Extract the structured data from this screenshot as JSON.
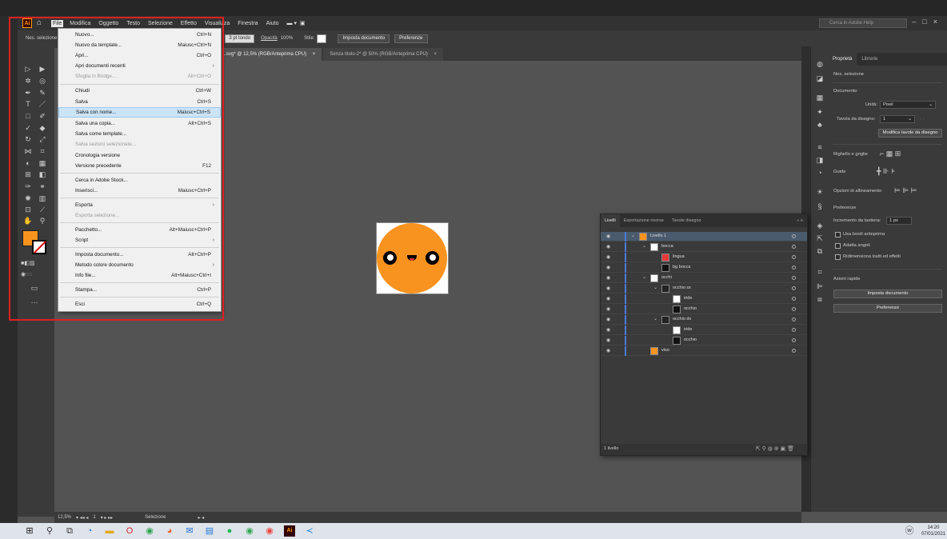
{
  "menubar": {
    "logo": "Ai",
    "items": [
      "File",
      "Modifica",
      "Oggetto",
      "Testo",
      "Selezione",
      "Effetto",
      "Visualizza",
      "Finestra",
      "Aiuto"
    ],
    "search_placeholder": "Cerca in Adobe Help"
  },
  "controlbar": {
    "selection": "Nes. selezione",
    "stroke": "3 pt tondo",
    "opacity_label": "Opacità",
    "opacity": "100%",
    "style_label": "Stile:",
    "setup_button": "Imposta documento",
    "prefs_button": "Preferenze"
  },
  "tabs": [
    {
      "label": "...svg* @ 12,5% (RGB/Anteprima CPU)",
      "close": "×"
    },
    {
      "label": "Senza titolo-2* @ 50% (RGB/Anteprima CPU)",
      "close": "×"
    }
  ],
  "file_menu": [
    {
      "label": "Nuovo...",
      "shortcut": "Ctrl+N"
    },
    {
      "label": "Nuovo da template...",
      "shortcut": "Maiusc+Ctrl+N"
    },
    {
      "label": "Apri...",
      "shortcut": "Ctrl+O"
    },
    {
      "label": "Apri documenti recenti",
      "shortcut": "›"
    },
    {
      "label": "Sfoglia in Bridge...",
      "shortcut": "Alt+Ctrl+O",
      "disabled": true
    },
    {
      "label": "Chiudi",
      "shortcut": "Ctrl+W"
    },
    {
      "label": "Salva",
      "shortcut": "Ctrl+S"
    },
    {
      "label": "Salva con nome...",
      "shortcut": "Maiusc+Ctrl+S",
      "highlighted": true
    },
    {
      "label": "Salva una copia...",
      "shortcut": "Alt+Ctrl+S"
    },
    {
      "label": "Salva come template...",
      "shortcut": ""
    },
    {
      "label": "Salva sezioni selezionate...",
      "shortcut": "",
      "disabled": true
    },
    {
      "label": "Cronologia versione",
      "shortcut": ""
    },
    {
      "label": "Versione precedente",
      "shortcut": "F12"
    },
    {
      "label": "Cerca in Adobe Stock...",
      "shortcut": ""
    },
    {
      "label": "Inserisci...",
      "shortcut": "Maiusc+Ctrl+P"
    },
    {
      "label": "Esporta",
      "shortcut": "›"
    },
    {
      "label": "Esporta selezione...",
      "shortcut": "",
      "disabled": true
    },
    {
      "label": "Pacchetto...",
      "shortcut": "Alt+Maiusc+Ctrl+P"
    },
    {
      "label": "Script",
      "shortcut": "›"
    },
    {
      "label": "Imposta documento...",
      "shortcut": "Alt+Ctrl+P"
    },
    {
      "label": "Metodo colore documento",
      "shortcut": "›"
    },
    {
      "label": "Info file...",
      "shortcut": "Alt+Maiusc+Ctrl+I"
    },
    {
      "label": "Stampa...",
      "shortcut": "Ctrl+P"
    },
    {
      "label": "Esci",
      "shortcut": "Ctrl+Q"
    }
  ],
  "properties": {
    "tabs": [
      "Proprietà",
      "Librerie"
    ],
    "no_selection": "Nes. selezione",
    "document": "Documento",
    "units_label": "Unità:",
    "units": "Pixel",
    "artboard_label": "Tavola da disegno:",
    "artboard": "1",
    "edit_artboards": "Modifica tavole da disegno",
    "rulers": "Righello e griglie",
    "guides": "Guide",
    "align_options": "Opzioni di allineamento",
    "preferences": "Preferenze",
    "keyboard_inc_label": "Incremento da tastiera:",
    "keyboard_inc": "1 px",
    "chk1": "Usa bordi anteprima",
    "chk2": "Adatta angoli",
    "chk3": "Ridimensiona tratti ed effetti",
    "quick_actions": "Azioni rapide",
    "setup_btn": "Imposta documento",
    "prefs_btn": "Preferenze"
  },
  "layers": {
    "tabs": [
      "Livelli",
      "Esportazione risorse",
      "Tavole disegno"
    ],
    "rows": [
      {
        "name": "Livello 1"
      },
      {
        "name": "bocca"
      },
      {
        "name": "lingua"
      },
      {
        "name": "bg bocca"
      },
      {
        "name": "occhi"
      },
      {
        "name": "occhio sx"
      },
      {
        "name": "iride"
      },
      {
        "name": "occhio"
      },
      {
        "name": "occhio dx"
      },
      {
        "name": "iride"
      },
      {
        "name": "occhio"
      },
      {
        "name": "viso"
      }
    ],
    "footer": "1 livello"
  },
  "status": {
    "zoom": "12,5%",
    "page": "1",
    "mode": "Selezione"
  },
  "taskbar": {
    "time": "14:20",
    "date": "07/01/2021"
  },
  "colors": {
    "fill": "#f7931e",
    "accent_red": "#e02020"
  }
}
